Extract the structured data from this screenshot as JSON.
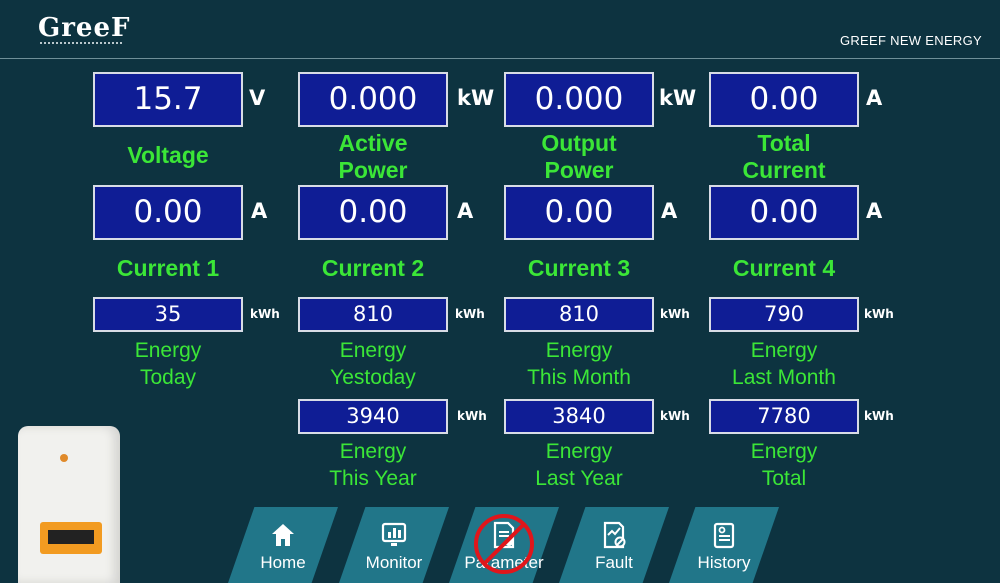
{
  "header": {
    "logo_text": "GreeF",
    "company": "GREEF NEW ENERGY"
  },
  "metrics_row1": [
    {
      "value": "15.7",
      "unit": "V",
      "label": "Voltage"
    },
    {
      "value": "0.000",
      "unit": "kW",
      "label_l1": "Active",
      "label_l2": "Power"
    },
    {
      "value": "0.000",
      "unit": "kW",
      "label_l1": "Output",
      "label_l2": "Power"
    },
    {
      "value": "0.00",
      "unit": "A",
      "label_l1": "Total",
      "label_l2": "Current"
    }
  ],
  "metrics_row2": [
    {
      "value": "0.00",
      "unit": "A",
      "label": "Current 1"
    },
    {
      "value": "0.00",
      "unit": "A",
      "label": "Current 2"
    },
    {
      "value": "0.00",
      "unit": "A",
      "label": "Current 3"
    },
    {
      "value": "0.00",
      "unit": "A",
      "label": "Current 4"
    }
  ],
  "energy_row1": [
    {
      "value": "35",
      "unit": "kWh",
      "label_l1": "Energy",
      "label_l2": "Today"
    },
    {
      "value": "810",
      "unit": "kWh",
      "label_l1": "Energy",
      "label_l2": "Yestoday"
    },
    {
      "value": "810",
      "unit": "kWh",
      "label_l1": "Energy",
      "label_l2": "This Month"
    },
    {
      "value": "790",
      "unit": "kWh",
      "label_l1": "Energy",
      "label_l2": "Last Month"
    }
  ],
  "energy_row2": [
    {
      "value": "3940",
      "unit": "kWh",
      "label_l1": "Energy",
      "label_l2": "This Year"
    },
    {
      "value": "3840",
      "unit": "kWh",
      "label_l1": "Energy",
      "label_l2": "Last Year"
    },
    {
      "value": "7780",
      "unit": "kWh",
      "label_l1": "Energy",
      "label_l2": "Total"
    }
  ],
  "nav": [
    {
      "label": "Home",
      "icon": "home-icon"
    },
    {
      "label": "Monitor",
      "icon": "monitor-icon"
    },
    {
      "label": "Parameter",
      "icon": "parameter-icon"
    },
    {
      "label": "Fault",
      "icon": "fault-icon"
    },
    {
      "label": "History",
      "icon": "history-icon"
    }
  ],
  "colors": {
    "background": "#0d3340",
    "panel": "#0f1d95",
    "label_green": "#3be637",
    "nav_button": "#217689",
    "prohibited_red": "#e0161b"
  }
}
